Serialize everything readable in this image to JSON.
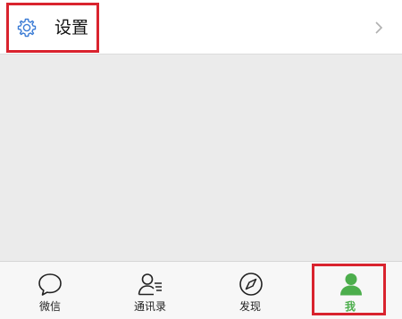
{
  "settings_row": {
    "label": "设置",
    "icon": "gear-icon",
    "chevron": "chevron-right-icon"
  },
  "tabbar": {
    "tabs": [
      {
        "label": "微信",
        "icon": "chat-bubble-icon",
        "active": false
      },
      {
        "label": "通讯录",
        "icon": "contacts-icon",
        "active": false
      },
      {
        "label": "发现",
        "icon": "compass-icon",
        "active": false
      },
      {
        "label": "我",
        "icon": "person-icon",
        "active": true
      }
    ]
  },
  "colors": {
    "accent": "#4cae4c",
    "highlight": "#d9232e",
    "gear_blue": "#3a7bd5",
    "background": "#ebebeb"
  }
}
